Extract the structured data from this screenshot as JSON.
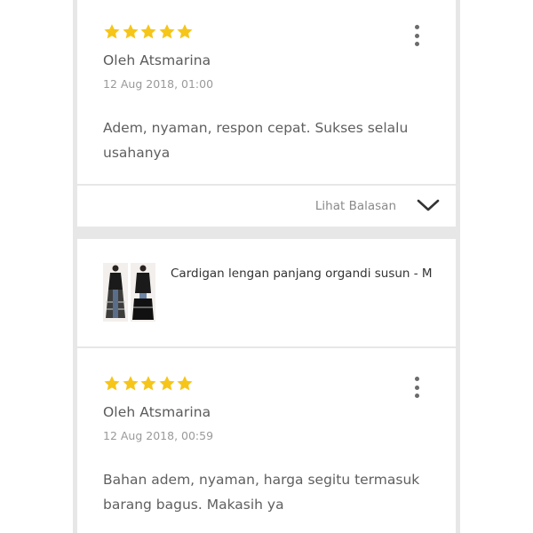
{
  "reviews": [
    {
      "rating": 5,
      "author": "Oleh Atsmarina",
      "date": "12 Aug 2018, 01:00",
      "comment": "Adem, nyaman, respon cepat. Sukses selalu usahanya",
      "reply_label": "Lihat Balasan"
    },
    {
      "rating": 5,
      "author": "Oleh Atsmarina",
      "date": "12 Aug 2018, 00:59",
      "comment": "Bahan adem, nyaman, harga segitu termasuk barang bagus. Makasih ya"
    }
  ],
  "product": {
    "name": "Cardigan lengan panjang organdi susun - M"
  },
  "colors": {
    "star": "#f6c519",
    "background_gutter": "#e7e7e7"
  },
  "icons": {
    "menu": "kebab-menu-icon",
    "expand": "chevron-down-icon",
    "rating": "star-icon"
  }
}
